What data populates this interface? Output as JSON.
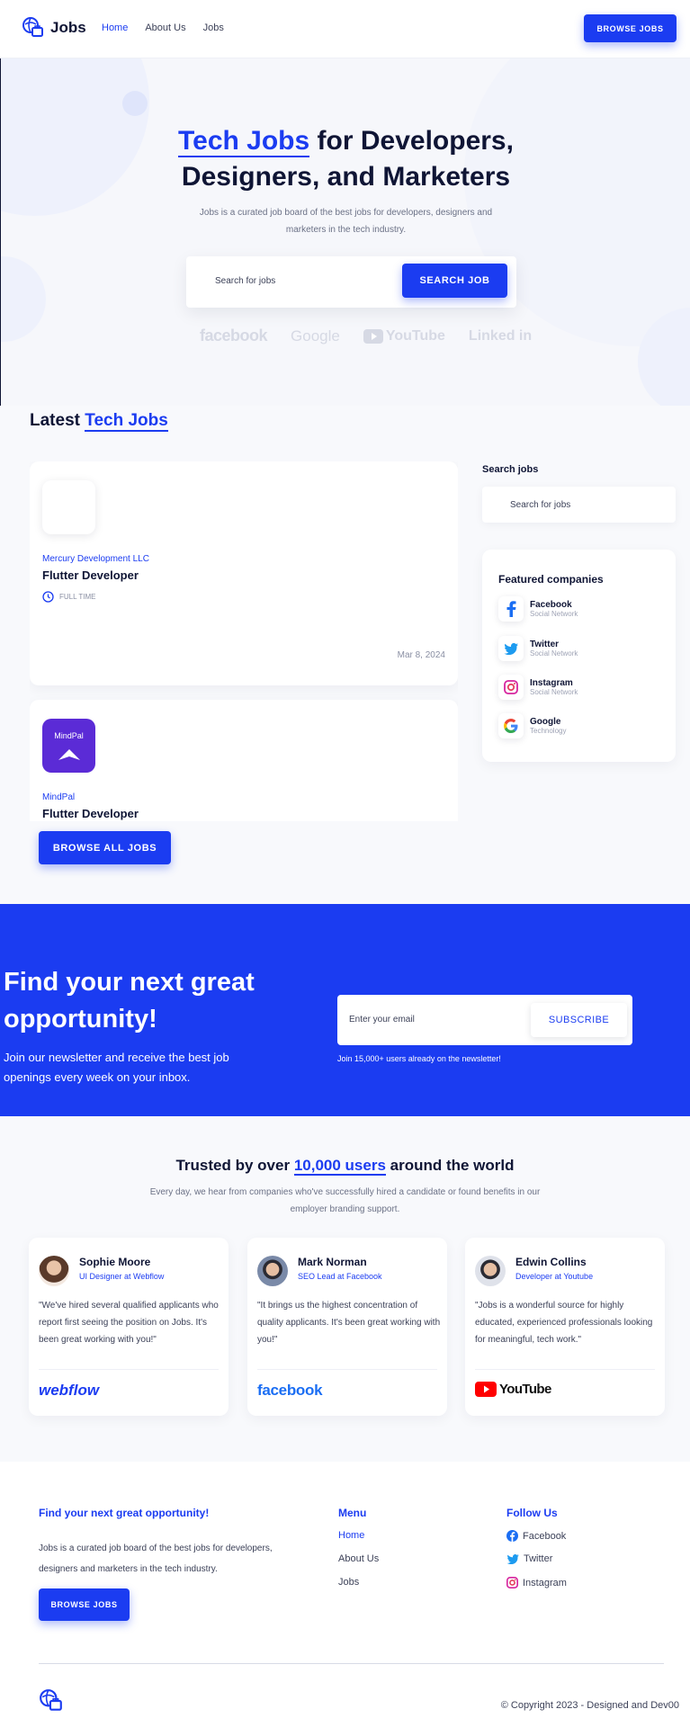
{
  "header": {
    "logo": "Jobs",
    "nav": [
      "Home",
      "About Us",
      "Jobs"
    ],
    "browse_btn": "BROWSE JOBS"
  },
  "hero": {
    "title_highlight": "Tech Jobs",
    "title_rest_1": " for Developers,",
    "title_line2": "Designers, and Marketers",
    "subtitle": "Jobs is a curated job board of the best jobs for developers, designers and marketers in the tech industry.",
    "search_placeholder": "Search for jobs",
    "search_btn": "SEARCH JOB",
    "logos": [
      "facebook",
      "Google",
      "YouTube",
      "Linked in"
    ]
  },
  "latest": {
    "title_prefix": "Latest ",
    "title_highlight": "Tech Jobs",
    "jobs": [
      {
        "company": "Mercury Development LLC",
        "title": "Flutter Developer",
        "type": "FULL TIME",
        "date": "Mar 8, 2024"
      },
      {
        "company": "MindPal",
        "title": "Flutter Developer",
        "logo_text": "MindPal"
      }
    ],
    "browse_all": "BROWSE ALL JOBS"
  },
  "sidebar": {
    "search_title": "Search jobs",
    "search_placeholder": "Search for jobs",
    "featured_title": "Featured companies",
    "companies": [
      {
        "name": "Facebook",
        "category": "Social Network"
      },
      {
        "name": "Twitter",
        "category": "Social Network"
      },
      {
        "name": "Instagram",
        "category": "Social Network"
      },
      {
        "name": "Google",
        "category": "Technology"
      }
    ]
  },
  "newsletter": {
    "title": "Find your next great opportunity!",
    "text": "Join our newsletter and receive the best job openings every week on your inbox.",
    "placeholder": "Enter your email",
    "subscribe": "SUBSCRIBE",
    "note": "Join 15,000+ users already on the newsletter!"
  },
  "trust": {
    "title_prefix": "Trusted by over ",
    "title_highlight": "10,000 users",
    "title_suffix": " around the world",
    "subtitle": "Every day, we hear from companies who've successfully hired a candidate or found benefits in our employer branding support.",
    "testimonials": [
      {
        "name": "Sophie Moore",
        "role": "UI Designer at Webflow",
        "quote": "\"We've hired several qualified applicants who report first seeing the position on Jobs. It's been great working with you!\"",
        "brand": "webflow"
      },
      {
        "name": "Mark Norman",
        "role": "SEO Lead at Facebook",
        "quote": "\"It brings us the highest concentration of quality applicants. It's been great working with you!\"",
        "brand": "facebook"
      },
      {
        "name": "Edwin Collins",
        "role": "Developer at Youtube",
        "quote": "\"Jobs is a wonderful source for highly educated, experienced professionals looking for meaningful, tech work.\"",
        "brand": "YouTube"
      }
    ]
  },
  "footer": {
    "title": "Find your next great opportunity!",
    "text": "Jobs is a curated job board of the best jobs for developers, designers and marketers in the tech industry.",
    "btn": "BROWSE JOBS",
    "menu_title": "Menu",
    "menu": [
      "Home",
      "About Us",
      "Jobs"
    ],
    "follow_title": "Follow Us",
    "social": [
      "Facebook",
      "Twitter",
      "Instagram"
    ],
    "copyright": "© Copyright 2023 - Designed and Dev00"
  },
  "colors": {
    "primary": "#1b3cf1",
    "dark": "#0f1535",
    "mindpal": "#5b2bd6"
  }
}
